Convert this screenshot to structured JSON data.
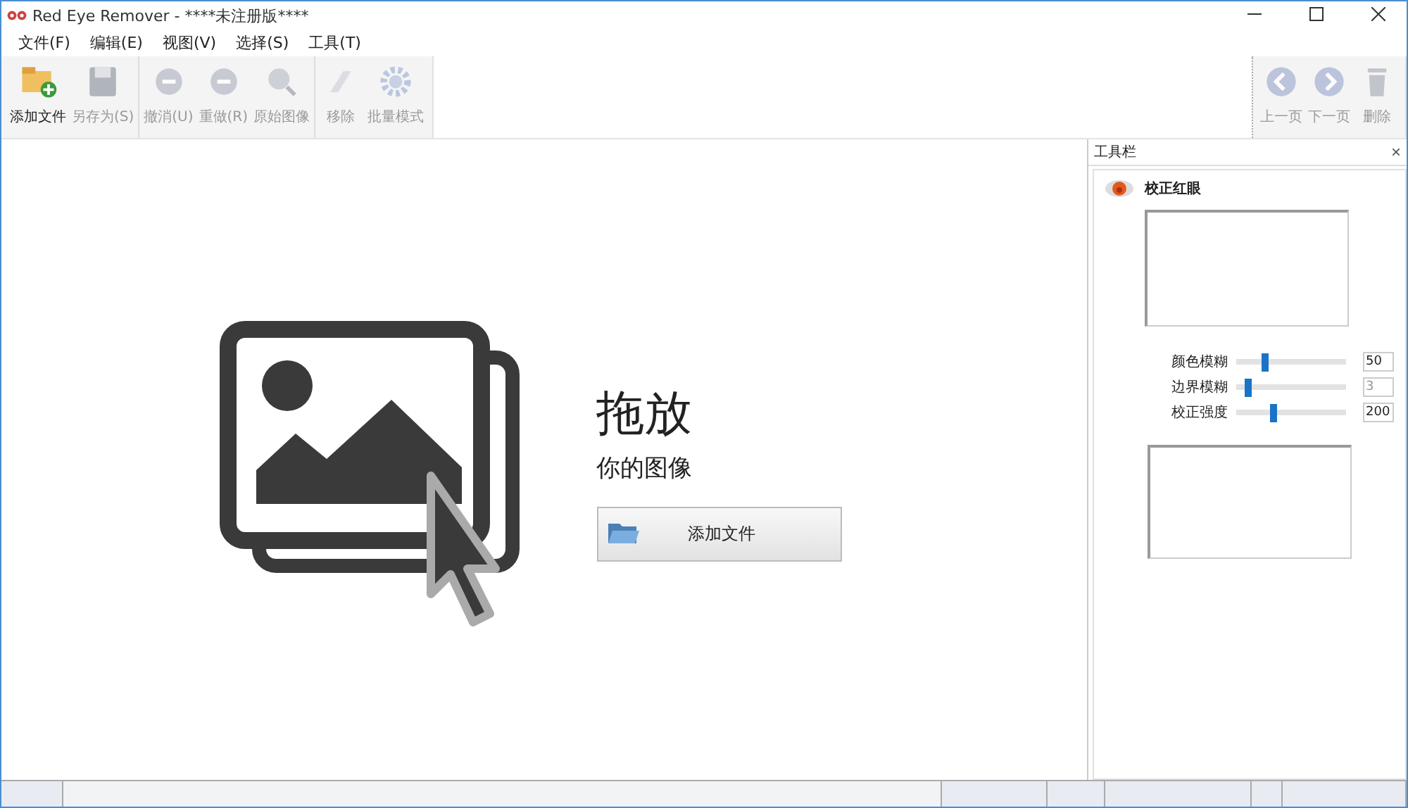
{
  "window": {
    "title": "Red Eye Remover - ****未注册版****"
  },
  "menu": [
    "文件(F)",
    "编辑(E)",
    "视图(V)",
    "选择(S)",
    "工具(T)"
  ],
  "toolbar_groups": [
    [
      {
        "label": "添加文件",
        "disabled": false
      },
      {
        "label": "另存为(S)",
        "disabled": true
      }
    ],
    [
      {
        "label": "撤消(U)",
        "disabled": true
      },
      {
        "label": "重做(R)",
        "disabled": true
      },
      {
        "label": "原始图像",
        "disabled": true
      }
    ],
    [
      {
        "label": "移除",
        "disabled": true
      },
      {
        "label": "批量模式",
        "disabled": true
      }
    ]
  ],
  "toolbar_right": [
    {
      "label": "上一页",
      "disabled": true
    },
    {
      "label": "下一页",
      "disabled": true
    },
    {
      "label": "删除",
      "disabled": true
    }
  ],
  "drop": {
    "title": "拖放",
    "subtitle": "你的图像",
    "button": "添加文件"
  },
  "panel": {
    "title": "工具栏",
    "close": "×",
    "section": "校正红眼",
    "sliders": [
      {
        "label": "颜色模糊",
        "level": 0.25,
        "value": "50",
        "disabled": false
      },
      {
        "label": "边界模糊",
        "level": 0.1,
        "value": "3",
        "disabled": true
      },
      {
        "label": "校正强度",
        "level": 0.33,
        "value": "200",
        "disabled": false
      }
    ]
  }
}
